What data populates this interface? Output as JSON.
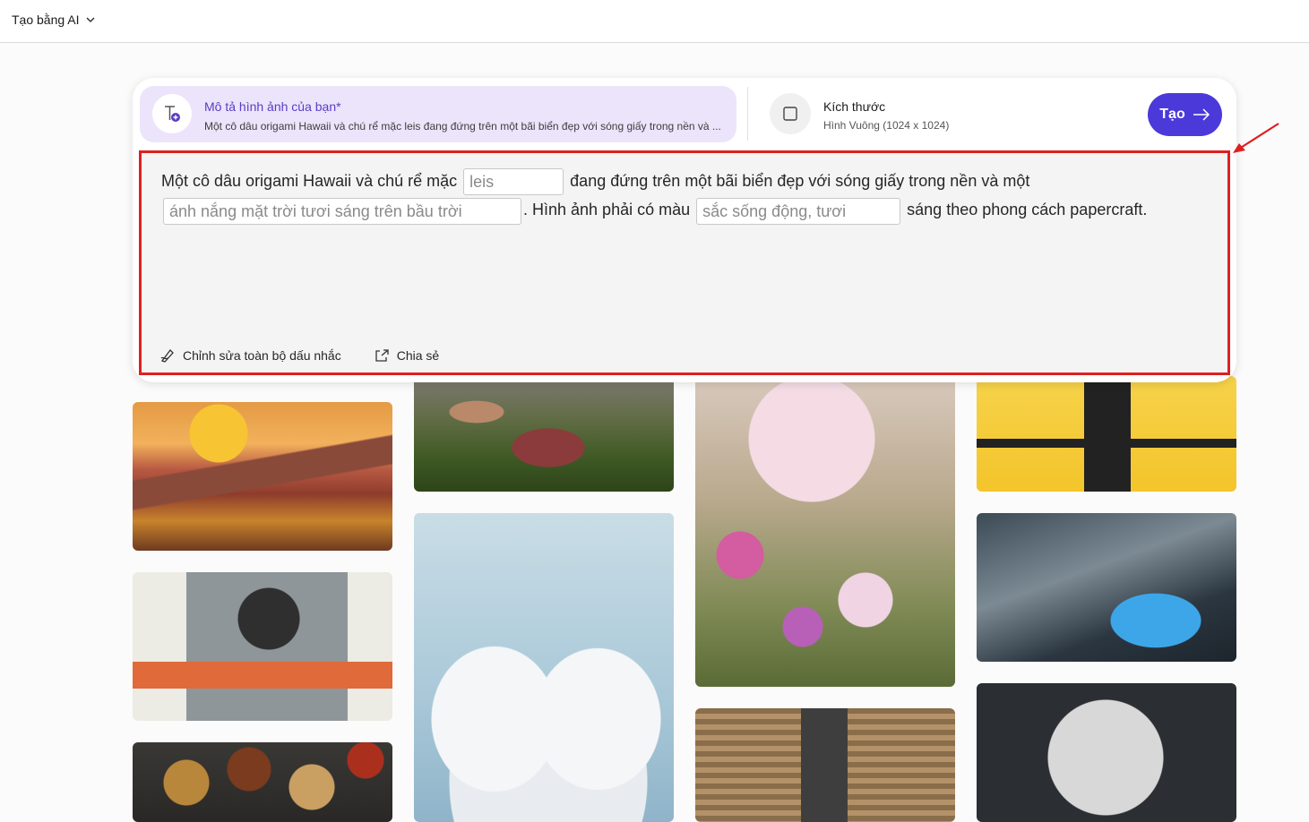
{
  "topbar": {
    "create_menu_label": "Tạo bằng AI"
  },
  "card": {
    "description": {
      "title": "Mô tả hình ảnh của bạn*",
      "summary": "Một cô dâu origami Hawaii và chú rể mặc leis đang đứng trên một bãi biển đẹp với sóng giấy trong nền và ..."
    },
    "size": {
      "title": "Kích thước",
      "value": "Hình Vuông (1024 x 1024)"
    },
    "create_button_label": "Tạo",
    "prompt": {
      "part1": "Một cô dâu origami Hawaii và chú rể mặc",
      "slot1": "leis",
      "part2": "đang đứng trên một bãi biển đẹp với sóng giấy trong nền và một",
      "slot2": "ánh nắng mặt trời tươi sáng trên bầu trời",
      "part3": ". Hình ảnh phải có màu",
      "slot3": "sắc sống động, tươi",
      "part4": "sáng theo phong cách papercraft."
    },
    "actions": {
      "edit_all": "Chỉnh sửa toàn bộ dấu nhắc",
      "share": "Chia sẻ"
    }
  },
  "colors": {
    "accent": "#4b39d9",
    "highlight": "#e01f1f",
    "panel": "#ece4fb"
  }
}
